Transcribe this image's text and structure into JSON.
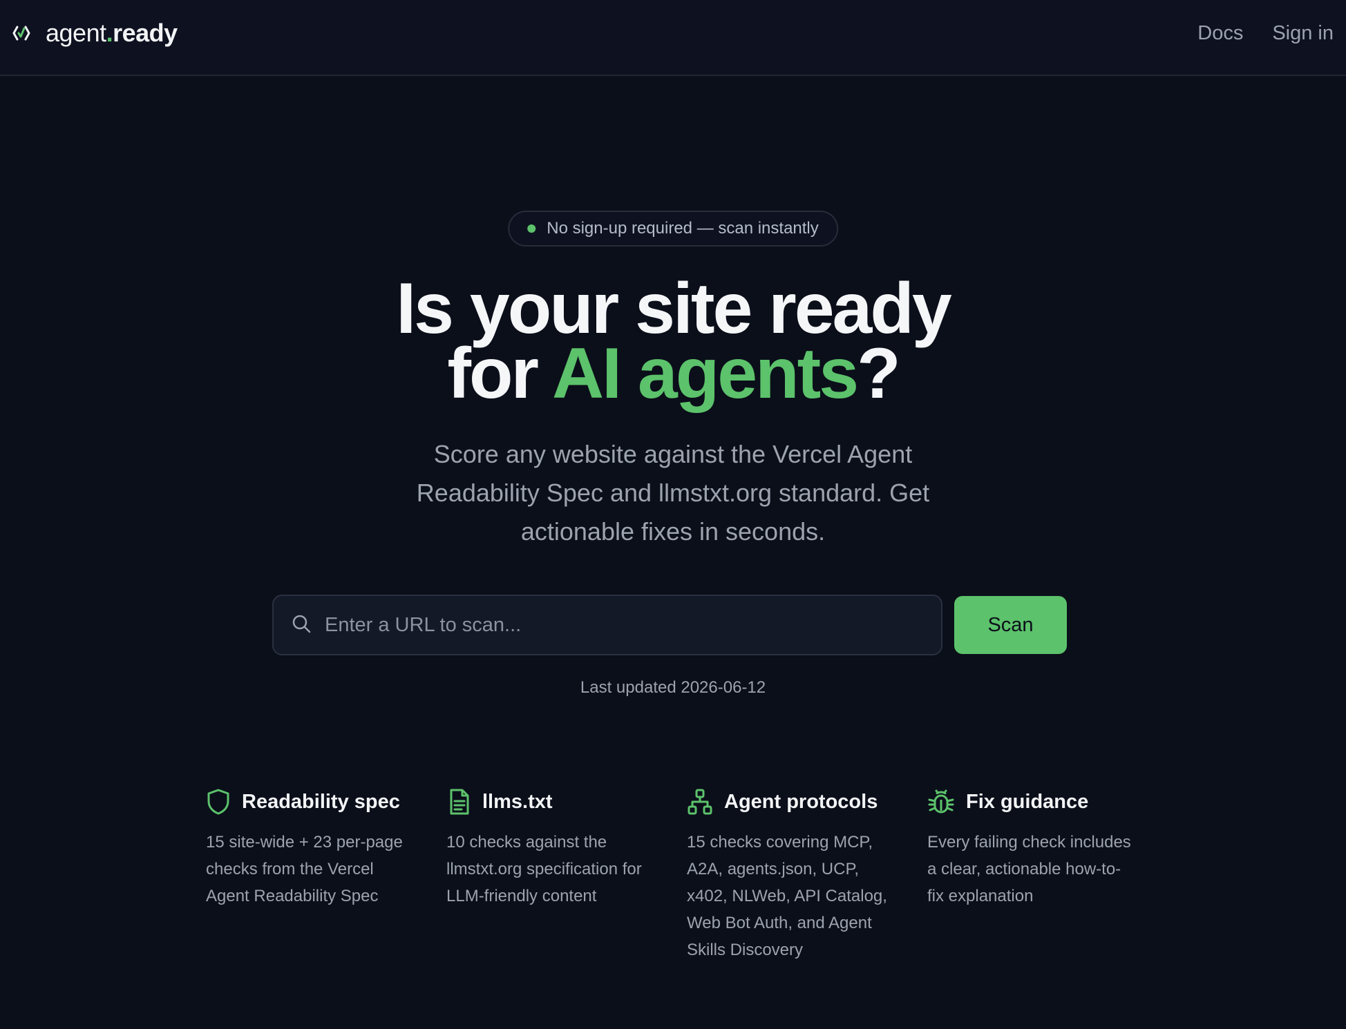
{
  "header": {
    "logo_name": "agent",
    "logo_dot": ".",
    "logo_suffix": "ready",
    "nav": [
      {
        "label": "Docs"
      },
      {
        "label": "Sign in"
      }
    ]
  },
  "hero": {
    "badge": "No sign-up required — scan instantly",
    "headline_line1": "Is your site ready",
    "headline_for": "for",
    "headline_accent": "AI agents",
    "headline_end": "?",
    "subtitle": "Score any website against the Vercel Agent Readability Spec and llmstxt.org standard. Get actionable fixes in seconds."
  },
  "search": {
    "placeholder": "Enter a URL to scan...",
    "value": "",
    "button_label": "Scan",
    "last_updated": "Last updated 2026-06-12"
  },
  "features": [
    {
      "icon": "shield-icon",
      "title": "Readability spec",
      "description": "15 site-wide + 23 per-page checks from the Vercel Agent Readability Spec"
    },
    {
      "icon": "document-icon",
      "title": "llms.txt",
      "description": "10 checks against the llmstxt.org specification for LLM-friendly content"
    },
    {
      "icon": "network-icon",
      "title": "Agent protocols",
      "description": "15 checks covering MCP, A2A, agents.json, UCP, x402, NLWeb, API Catalog, Web Bot Auth, and Agent Skills Discovery"
    },
    {
      "icon": "bug-icon",
      "title": "Fix guidance",
      "description": "Every failing check includes a clear, actionable how-to-fix explanation"
    }
  ],
  "colors": {
    "background": "#0b0f1a",
    "accent": "#5cc26b",
    "muted_text": "#9ca3af"
  }
}
